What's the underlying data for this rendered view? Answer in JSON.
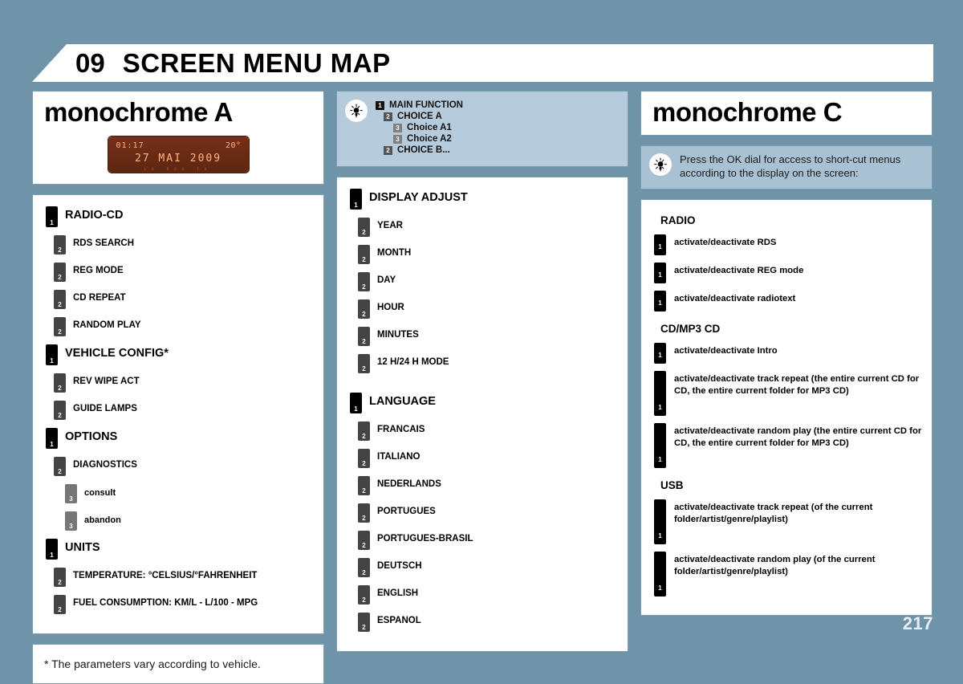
{
  "header": {
    "chapter_number": "09",
    "chapter_title": "SCREEN MENU MAP"
  },
  "page_number": "217",
  "icons": {
    "bulb": "light-bulb-icon"
  },
  "left_column": {
    "title": "monochrome A",
    "lcd": {
      "time": "01:17",
      "temperature": "20°",
      "date": "27 MAI 2009",
      "footer": "LO  RDS  TA"
    },
    "tree": [
      {
        "level": 1,
        "label": "RADIO-CD"
      },
      {
        "level": 2,
        "label": "RDS SEARCH"
      },
      {
        "level": 2,
        "label": "REG MODE"
      },
      {
        "level": 2,
        "label": "CD REPEAT"
      },
      {
        "level": 2,
        "label": "RANDOM PLAY"
      },
      {
        "level": 1,
        "label": "VEHICLE CONFIG*"
      },
      {
        "level": 2,
        "label": "REV WIPE ACT"
      },
      {
        "level": 2,
        "label": "GUIDE LAMPS"
      },
      {
        "level": 1,
        "label": "OPTIONS"
      },
      {
        "level": 2,
        "label": "DIAGNOSTICS"
      },
      {
        "level": 3,
        "label": "consult"
      },
      {
        "level": 3,
        "label": "abandon"
      },
      {
        "level": 1,
        "label": "UNITS"
      },
      {
        "level": 2,
        "label": "TEMPERATURE: °CELSIUS/°FAHRENHEIT"
      },
      {
        "level": 2,
        "label": "FUEL CONSUMPTION: KM/L - L/100 - MPG"
      }
    ],
    "footnote": "* The parameters vary according to vehicle."
  },
  "center_column": {
    "legend": [
      {
        "level": 1,
        "label": "MAIN FUNCTION"
      },
      {
        "level": 2,
        "label": "CHOICE A"
      },
      {
        "level": 3,
        "label": "Choice A1"
      },
      {
        "level": 3,
        "label": "Choice A2"
      },
      {
        "level": 2,
        "label": "CHOICE B..."
      }
    ],
    "tree": [
      {
        "level": 1,
        "label": "DISPLAY ADJUST"
      },
      {
        "level": 2,
        "label": "YEAR"
      },
      {
        "level": 2,
        "label": "MONTH"
      },
      {
        "level": 2,
        "label": "DAY"
      },
      {
        "level": 2,
        "label": "HOUR"
      },
      {
        "level": 2,
        "label": "MINUTES"
      },
      {
        "level": 2,
        "label": "12 H/24 H MODE"
      },
      {
        "level": 1,
        "label": "LANGUAGE",
        "gap_before": true
      },
      {
        "level": 2,
        "label": "FRANCAIS"
      },
      {
        "level": 2,
        "label": "ITALIANO"
      },
      {
        "level": 2,
        "label": "NEDERLANDS"
      },
      {
        "level": 2,
        "label": "PORTUGUES"
      },
      {
        "level": 2,
        "label": "PORTUGUES-BRASIL"
      },
      {
        "level": 2,
        "label": "DEUTSCH"
      },
      {
        "level": 2,
        "label": "ENGLISH"
      },
      {
        "level": 2,
        "label": "ESPANOL"
      }
    ]
  },
  "right_column": {
    "title": "monochrome C",
    "note": "Press the OK dial for access to short-cut menus according to the display on the screen:",
    "sections": [
      {
        "heading": "RADIO",
        "items": [
          {
            "label": "activate/deactivate RDS",
            "tall": false
          },
          {
            "label": "activate/deactivate REG mode",
            "tall": false
          },
          {
            "label": "activate/deactivate radiotext",
            "tall": false
          }
        ]
      },
      {
        "heading": "CD/MP3 CD",
        "items": [
          {
            "label": "activate/deactivate Intro",
            "tall": false
          },
          {
            "label": "activate/deactivate track repeat (the entire current CD for CD, the entire current folder for MP3 CD)",
            "tall": true
          },
          {
            "label": "activate/deactivate random play (the entire current CD for CD, the entire current folder for MP3 CD)",
            "tall": true
          }
        ]
      },
      {
        "heading": "USB",
        "items": [
          {
            "label": "activate/deactivate track repeat (of the current folder/artist/genre/playlist)",
            "tall": true
          },
          {
            "label": "activate/deactivate random play (of the current folder/artist/genre/playlist)",
            "tall": true
          }
        ]
      }
    ]
  },
  "colors": {
    "page_background": "#6f93a8",
    "panel_background": "#ffffff",
    "panel_border": "#7c9db0",
    "legend_background": "#b6ccdc",
    "note_background": "#a8c2d4",
    "lcd_background": "#6b2c10",
    "lcd_text": "#ffb582",
    "level1_badge": "#000000",
    "level2_badge": "#444444",
    "level3_badge": "#777777"
  }
}
